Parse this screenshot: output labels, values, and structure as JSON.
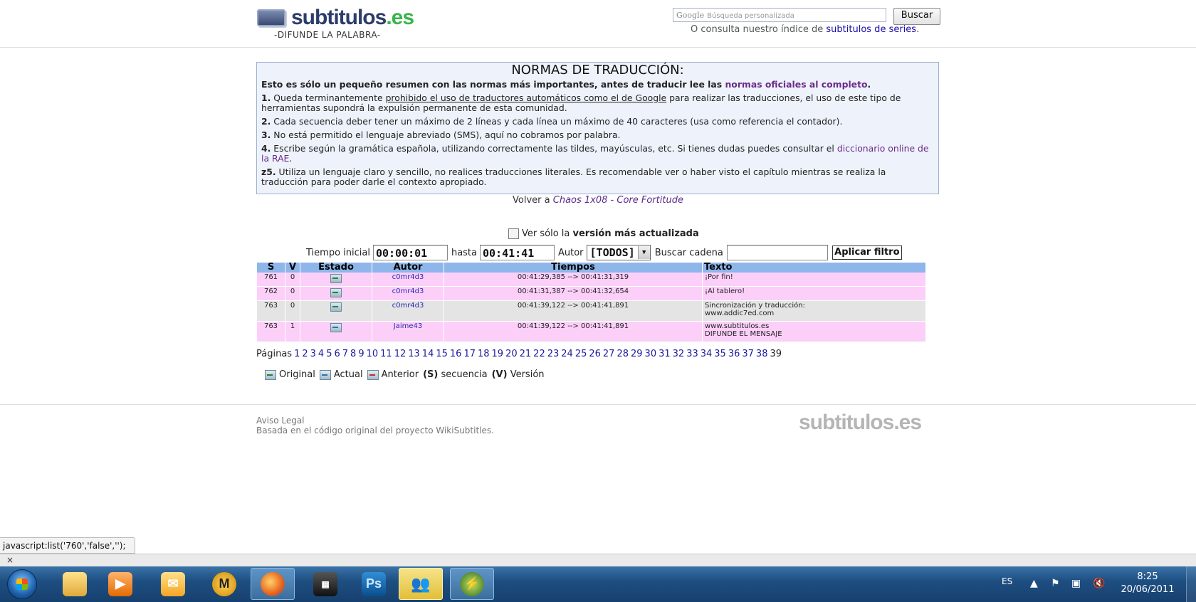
{
  "header": {
    "logo_main": "subtitulos",
    "logo_ext": ".es",
    "tagline": "-DIFUNDE LA PALABRA-",
    "search_google": "Google",
    "search_placeholder": "Búsqueda personalizada",
    "search_button": "Buscar",
    "consulta_prefix": "O consulta nuestro índice de",
    "consulta_link": "subtitulos de series",
    "consulta_suffix": "."
  },
  "normas": {
    "title": "NORMAS DE TRADUCCIÓN:",
    "intro": "Esto es sólo un pequeño resumen con las normas más importantes, antes de traducir lee las",
    "intro_link": "normas oficiales al completo",
    "r1_num": "1.",
    "r1_a": "Queda terminantemente",
    "r1_u": "prohibido el uso de traductores automáticos como el de Google",
    "r1_b": "para realizar las traducciones, el uso de este tipo de herramientas supondrá la expulsión permanente de esta comunidad.",
    "r2_num": "2.",
    "r2": "Cada secuencia deber tener un máximo de 2 líneas y cada línea un máximo de 40 caracteres (usa como referencia el contador).",
    "r3_num": "3.",
    "r3": "No está permitido el lenguaje abreviado (SMS), aquí no cobramos por palabra.",
    "r4_num": "4.",
    "r4_a": "Escribe según la gramática española, utilizando correctamente las tildes, mayúsculas, etc. Si tienes dudas puedes consultar el",
    "r4_link": "diccionario online de la RAE",
    "r4_b": ".",
    "r5_num": "z5.",
    "r5": "Utiliza un lenguaje claro y sencillo, no realices traducciones literales. Es recomendable ver o haber visto el capítulo mientras se realiza la traducción para poder darle el contexto apropiado."
  },
  "volver": {
    "prefix": "Volver a",
    "link": "Chaos 1x08 - Core Fortitude"
  },
  "filter": {
    "checkbox_prefix": "Ver sólo la",
    "checkbox_bold": "versión más actualizada",
    "tiempo_label": "Tiempo inicial",
    "tiempo_value": "00:00:01",
    "hasta_label": "hasta",
    "hasta_value": "00:41:41",
    "autor_label": "Autor",
    "autor_value": "[TODOS]",
    "buscar_label": "Buscar cadena",
    "buscar_value": "",
    "apply_button": "Aplicar filtro"
  },
  "table": {
    "headers": [
      "S",
      "V",
      "Estado",
      "Autor",
      "Tiempos",
      "Texto"
    ],
    "rows": [
      {
        "s": "761",
        "v": "0",
        "autor": "c0mr4d3",
        "tiempos": "00:41:29,385 --> 00:41:31,319",
        "texto1": "¡Por fin!",
        "texto2": ""
      },
      {
        "s": "762",
        "v": "0",
        "autor": "c0mr4d3",
        "tiempos": "00:41:31,387 --> 00:41:32,654",
        "texto1": "¡Al tablero!",
        "texto2": ""
      },
      {
        "s": "763",
        "v": "0",
        "autor": "c0mr4d3",
        "tiempos": "00:41:39,122 --> 00:41:41,891",
        "texto1": "Sincronización y traducción:",
        "texto2": "www.addic7ed.com"
      },
      {
        "s": "763",
        "v": "1",
        "autor": "Jaime43",
        "tiempos": "00:41:39,122 --> 00:41:41,891",
        "texto1": "www.subtitulos.es",
        "texto2": "DIFUNDE EL MENSAJE"
      }
    ]
  },
  "pages": {
    "label": "Páginas",
    "links": [
      "1",
      "2",
      "3",
      "4",
      "5",
      "6",
      "7",
      "8",
      "9",
      "10",
      "11",
      "12",
      "13",
      "14",
      "15",
      "16",
      "17",
      "18",
      "19",
      "20",
      "21",
      "22",
      "23",
      "24",
      "25",
      "26",
      "27",
      "28",
      "29",
      "30",
      "31",
      "32",
      "33",
      "34",
      "35",
      "36",
      "37",
      "38"
    ],
    "current": "39"
  },
  "legend": {
    "original": "Original",
    "actual": "Actual",
    "anterior": "Anterior",
    "s_code": "(S)",
    "s_text": "secuencia",
    "v_code": "(V)",
    "v_text": "Versión"
  },
  "footer": {
    "aviso": "Aviso Legal",
    "basada": "Basada en el código original del proyecto WikiSubtitles.",
    "logo": "subtitulos.es"
  },
  "status": {
    "url": "javascript:list('760','false','');",
    "close": "×"
  },
  "taskbar": {
    "lang": "ES",
    "time": "8:25",
    "date": "20/06/2011",
    "ps_label": "Ps"
  },
  "colors": {
    "logo_blue": "#2c3d6b",
    "logo_green": "#39b54a",
    "table_header": "#8fb6ea",
    "row_pink": "#fccff9",
    "row_grey": "#e4e4e4",
    "normas_bg": "#eef3fb"
  }
}
